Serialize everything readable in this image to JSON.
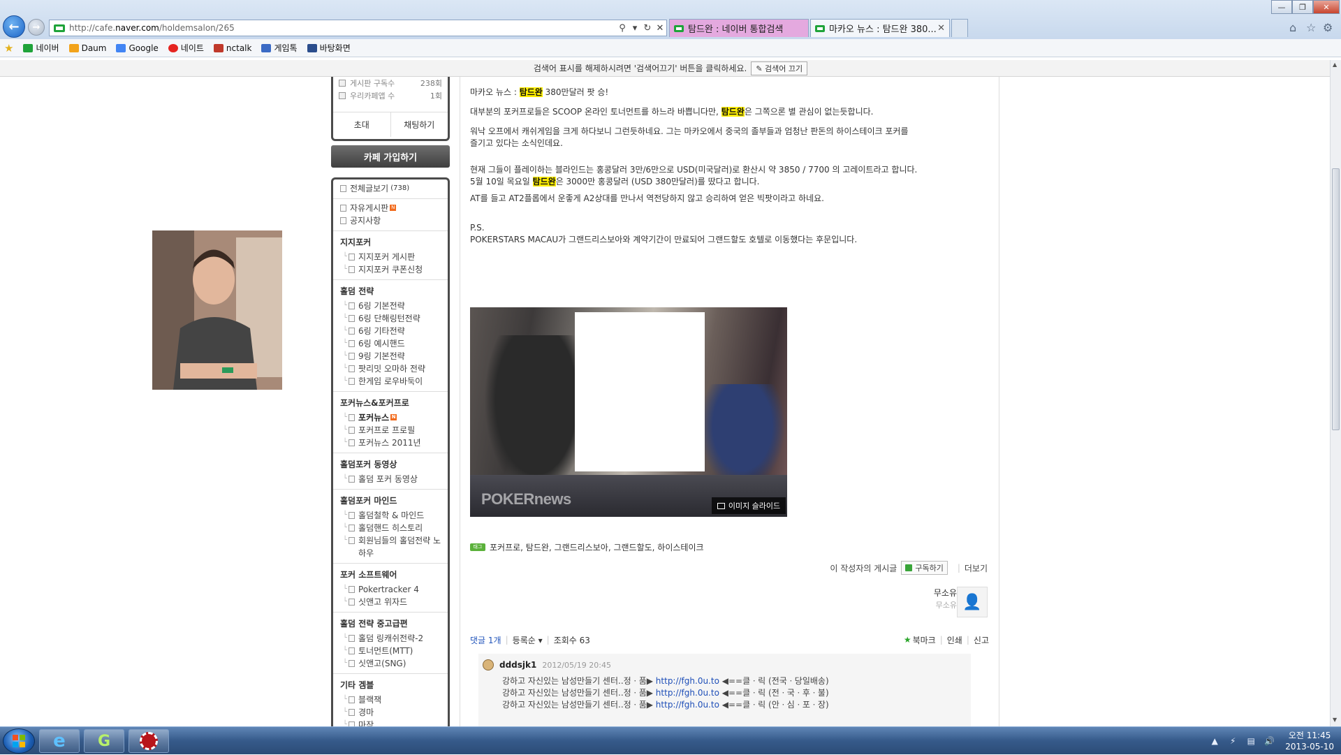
{
  "browser": {
    "url_prefix": "http://cafe.",
    "url_domain": "naver.com",
    "url_path": "/holdemsalon/265",
    "tabs": [
      {
        "label": "탐드완 : 네이버 통합검색"
      },
      {
        "label": "마카오 뉴스 : 탐드완 380..."
      }
    ],
    "favorites": [
      {
        "label": "네이버",
        "color": "#1fa33a"
      },
      {
        "label": "Daum",
        "color": "#f2a31b"
      },
      {
        "label": "Google",
        "color": "#4285f4"
      },
      {
        "label": "네이트",
        "color": "#e52420"
      },
      {
        "label": "nctalk",
        "color": "#c0392b"
      },
      {
        "label": "게임톡",
        "color": "#3b6bc5"
      },
      {
        "label": "바탕화면",
        "color": "#2b4d8c"
      }
    ],
    "infobar_text": "검색어 표시를 해제하시려면 '검색어끄기' 버튼을 클릭하세요.",
    "infobar_button": "검색어 끄기"
  },
  "cafe_box": {
    "stats": [
      {
        "label": "게시판 구독수",
        "value": "238회"
      },
      {
        "label": "우리카페앱 수",
        "value": "1회"
      }
    ],
    "invite_label": "초대",
    "chat_label": "채팅하기",
    "join_label": "카페 가입하기"
  },
  "menu": {
    "top": [
      {
        "label": "전체글보기",
        "count": "(738)"
      },
      {
        "label": "자유게시판",
        "new": "N"
      },
      {
        "label": "공지사항"
      }
    ],
    "sections": [
      {
        "title": "지지포커",
        "items": [
          "지지포커 게시판",
          "지지포커 쿠폰신청"
        ]
      },
      {
        "title": "홀덤 전략",
        "items": [
          "6링 기본전략",
          "6링 단해링턴전략",
          "6링 기타전략",
          "6링 예시핸드",
          "9링 기본전략",
          "팟리밋 오마하 전략",
          "한게임 로우바둑이"
        ]
      },
      {
        "title": "포커뉴스&포커프로",
        "items": [
          "포커뉴스",
          "포커프로 프로필",
          "포커뉴스 2011년"
        ]
      },
      {
        "title": "홀덤포커 동영상",
        "items": [
          "홀덤 포커 동영상"
        ]
      },
      {
        "title": "홀덤포커 마인드",
        "items": [
          "홀덤철학 & 마인드",
          "홀덤핸드 히스토리",
          "회원님들의 홀덤전략 노하우"
        ]
      },
      {
        "title": "포커 소프트웨어",
        "items": [
          "Pokertracker 4",
          "싯앤고 위자드"
        ]
      },
      {
        "title": "홀덤 전략 중고급편",
        "items": [
          "홀덤 링캐쉬전략-2",
          "토너먼트(MTT)",
          "싯앤고(SNG)"
        ]
      },
      {
        "title": "기타 겜블",
        "items": [
          "블랙잭",
          "경마",
          "마작"
        ]
      }
    ],
    "news_new_badge": "N"
  },
  "article": {
    "p1_a": "마카오 뉴스 : ",
    "p1_hl": "탐드완",
    "p1_b": " 380만달러 팟 승!",
    "p2_a": "대부분의 포커프로들은 SCOOP 온라인 토너먼트를 하느라 바쁩니다만, ",
    "p2_hl": "탐드완",
    "p2_b": "은 그쪽으론 별 관심이 없는듯합니다.",
    "p3_l1": "워낙 오프에서 캐쉬게임을 크게 하다보니 그런듯하네요. 그는 마카오에서 중국의 졸부들과 엄청난 판돈의 하이스테이크 포커를",
    "p3_l2": "즐기고 있다는 소식인데요.",
    "p4_l1": "현재 그들이 플레이하는 블라인드는 홍콩달러 3만/6만으로  USD(미국달러)로 환산시 약 3850 / 7700 의 고레이트라고 합니다.",
    "p4_l2_a": "5월 10일 목요일 ",
    "p4_l2_hl": "탐드완",
    "p4_l2_b": "은 3000만 홍콩달러 (USD 380만달러)를 땄다고 합니다.",
    "p5": "AT를 들고 AT2플롭에서 운좋게 A2상대를 만나서 역전당하지 않고 승리하여 얻은 빅팟이라고 하네요.",
    "p6_l1": "P.S.",
    "p6_l2": "POKERSTARS MACAU가 그랜드리스보아와 계약기간이 만료되어 그랜드할도 호텔로 이동했다는 후문입니다.",
    "image_watermark": "POKERnews",
    "image_slide_label": "이미지 슬라이드",
    "tag_icon": "태그",
    "tags": "포커프로, 탐드완, 그랜드리스보아, 그랜드할도, 하이스테이크",
    "author_posts_label": "이 작성자의 게시글",
    "subscribe_label": "구독하기",
    "more_label": "더보기",
    "author_name": "무소유",
    "author_sub": "무소유"
  },
  "comments_bar": {
    "comment_label": "댓글",
    "comment_count": "1개",
    "register_label": "등록순",
    "views_label": "조회수 63",
    "bookmark_label": "북마크",
    "print_label": "인쇄",
    "report_label": "신고"
  },
  "comment": {
    "user": "dddsjk1",
    "date": "2012/05/19 20:45",
    "lines": [
      {
        "text": "강하고 자신있는 남성만들기 센터..정ㆍ품▶ ",
        "link": "http://fgh.0u.to",
        "tail": " ◀==클ㆍ릭 (전국ㆍ당일배송)"
      },
      {
        "text": "강하고 자신있는 남성만들기 센터..정ㆍ품▶ ",
        "link": "http://fgh.0u.to",
        "tail": " ◀==클ㆍ릭 (전ㆍ국ㆍ후ㆍ불)"
      },
      {
        "text": "강하고 자신있는 남성만들기 센터..정ㆍ품▶ ",
        "link": "http://fgh.0u.to",
        "tail": " ◀==클ㆍ릭 (안ㆍ심ㆍ포ㆍ장)"
      }
    ]
  },
  "taskbar": {
    "clock_time": "오전 11:45",
    "clock_date": "2013-05-10"
  },
  "colors": {
    "highlight": "#ffef00",
    "menu_border": "#4b4b4b",
    "link_blue": "#1f4fb8",
    "tab_active_pink": "#e4a9df"
  }
}
